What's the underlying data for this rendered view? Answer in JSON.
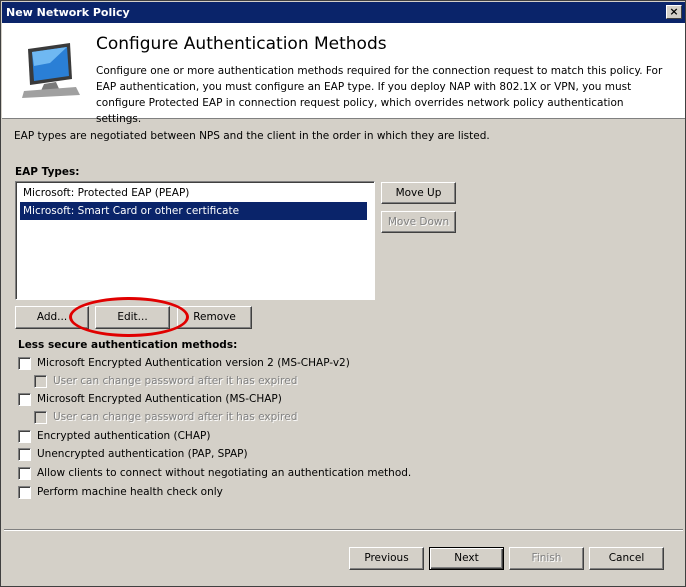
{
  "window": {
    "title": "New Network Policy",
    "close_label": "×"
  },
  "header": {
    "title": "Configure Authentication Methods",
    "description": "Configure one or more authentication methods required for the connection request to match this policy. For EAP authentication, you must configure an EAP type. If you deploy NAP with 802.1X or VPN, you must configure Protected EAP in connection request policy, which overrides network policy authentication settings.",
    "icon": "computer-monitor-icon"
  },
  "intro": "EAP types are negotiated between NPS and the client in the order in which they are listed.",
  "eap": {
    "label": "EAP Types:",
    "items": [
      {
        "label": "Microsoft: Protected EAP (PEAP)",
        "selected": false
      },
      {
        "label": "Microsoft: Smart Card or other certificate",
        "selected": true
      }
    ],
    "move_up": "Move Up",
    "move_down": "Move Down",
    "add": "Add...",
    "edit": "Edit...",
    "remove": "Remove"
  },
  "less_secure": {
    "label": "Less secure authentication methods:",
    "options": [
      {
        "label": "Microsoft Encrypted Authentication version 2 (MS-CHAP-v2)",
        "checked": false,
        "enabled": true
      },
      {
        "label": "User can change password after it has expired",
        "checked": false,
        "enabled": false
      },
      {
        "label": "Microsoft Encrypted Authentication (MS-CHAP)",
        "checked": false,
        "enabled": true
      },
      {
        "label": "User can change password after it has expired",
        "checked": false,
        "enabled": false
      },
      {
        "label": "Encrypted authentication (CHAP)",
        "checked": false,
        "enabled": true
      },
      {
        "label": "Unencrypted authentication (PAP, SPAP)",
        "checked": false,
        "enabled": true
      },
      {
        "label": "Allow clients to connect without negotiating an authentication method.",
        "checked": false,
        "enabled": true
      },
      {
        "label": "Perform machine health check only",
        "checked": false,
        "enabled": true
      }
    ]
  },
  "footer": {
    "previous": "Previous",
    "next": "Next",
    "finish": "Finish",
    "cancel": "Cancel"
  },
  "colors": {
    "titlebar": "#0a246a",
    "selection": "#0a246a",
    "annotation": "#e00000"
  }
}
